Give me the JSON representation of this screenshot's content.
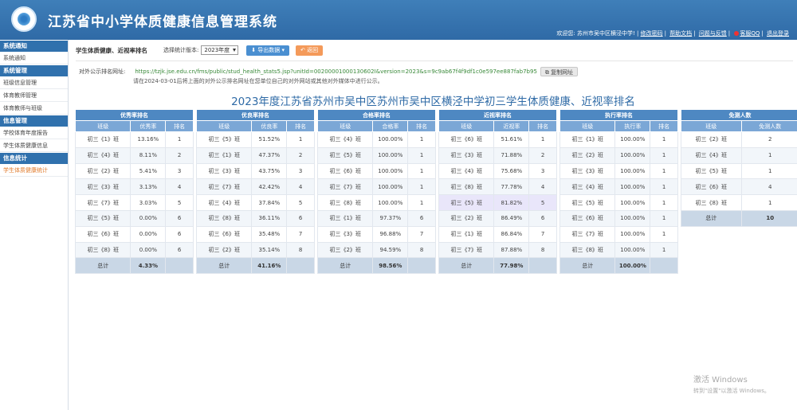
{
  "header": {
    "title": "江苏省中小学体质健康信息管理系统",
    "welcome": "欢迎您: 苏州市吴中区横泾中学! |",
    "links": [
      "修改密码",
      "帮助文档",
      "问题与反馈",
      "客服QQ",
      "退出登录"
    ]
  },
  "sidebar": {
    "sections": [
      {
        "head": "系统通知",
        "items": [
          "系统通知"
        ]
      },
      {
        "head": "系统管理",
        "items": [
          "班级信息管理",
          "体育教师管理",
          "体育教师与班级"
        ]
      },
      {
        "head": "信息管理",
        "items": [
          "学校体育年度报告",
          "学生体质健康信息"
        ]
      },
      {
        "head": "信息统计",
        "items": [
          "学生体质健康统计"
        ]
      }
    ]
  },
  "toolbar": {
    "title": "学生体质健康、近视率排名",
    "version_label": "选择统计版本:",
    "version_value": "2023年度",
    "export_label": "导出数据",
    "back_label": "返回"
  },
  "url": {
    "label": "对外公示排名网址:",
    "value": "https://tzjk.jse.edu.cn/fms/public/stud_health_stats5.jsp?unitId=00200001000130602I&version=2023&s=9c9ab67f4f9df1c0e597ee887fab7b95",
    "copy_label": "复制网址",
    "notice": "请在2024-03-01后将上面的对外公示排名网址在您单位自己的对外网站或其他对外媒体中进行公示。"
  },
  "heading": "2023年度江苏省苏州市吴中区苏州市吴中区横泾中学初三学生体质健康、近视率排名",
  "tables": [
    {
      "caption": "优秀率排名",
      "cols": [
        "班级",
        "优秀率",
        "排名"
      ],
      "highlight": -1,
      "rows": [
        [
          "初三《1》班",
          "13.16%",
          "1"
        ],
        [
          "初三《4》班",
          "8.11%",
          "2"
        ],
        [
          "初三《2》班",
          "5.41%",
          "3"
        ],
        [
          "初三《3》班",
          "3.13%",
          "4"
        ],
        [
          "初三《7》班",
          "3.03%",
          "5"
        ],
        [
          "初三《5》班",
          "0.00%",
          "6"
        ],
        [
          "初三《6》班",
          "0.00%",
          "6"
        ],
        [
          "初三《8》班",
          "0.00%",
          "6"
        ]
      ],
      "total": [
        "总计",
        "4.33%",
        ""
      ]
    },
    {
      "caption": "优良率排名",
      "cols": [
        "班级",
        "优良率",
        "排名"
      ],
      "highlight": -1,
      "rows": [
        [
          "初三《5》班",
          "51.52%",
          "1"
        ],
        [
          "初三《1》班",
          "47.37%",
          "2"
        ],
        [
          "初三《3》班",
          "43.75%",
          "3"
        ],
        [
          "初三《7》班",
          "42.42%",
          "4"
        ],
        [
          "初三《4》班",
          "37.84%",
          "5"
        ],
        [
          "初三《8》班",
          "36.11%",
          "6"
        ],
        [
          "初三《6》班",
          "35.48%",
          "7"
        ],
        [
          "初三《2》班",
          "35.14%",
          "8"
        ]
      ],
      "total": [
        "总计",
        "41.16%",
        ""
      ]
    },
    {
      "caption": "合格率排名",
      "cols": [
        "班级",
        "合格率",
        "排名"
      ],
      "highlight": -1,
      "rows": [
        [
          "初三《4》班",
          "100.00%",
          "1"
        ],
        [
          "初三《5》班",
          "100.00%",
          "1"
        ],
        [
          "初三《6》班",
          "100.00%",
          "1"
        ],
        [
          "初三《7》班",
          "100.00%",
          "1"
        ],
        [
          "初三《8》班",
          "100.00%",
          "1"
        ],
        [
          "初三《1》班",
          "97.37%",
          "6"
        ],
        [
          "初三《3》班",
          "96.88%",
          "7"
        ],
        [
          "初三《2》班",
          "94.59%",
          "8"
        ]
      ],
      "total": [
        "总计",
        "98.56%",
        ""
      ]
    },
    {
      "caption": "近视率排名",
      "cols": [
        "班级",
        "近视率",
        "排名"
      ],
      "highlight": 4,
      "rows": [
        [
          "初三《6》班",
          "51.61%",
          "1"
        ],
        [
          "初三《3》班",
          "71.88%",
          "2"
        ],
        [
          "初三《4》班",
          "75.68%",
          "3"
        ],
        [
          "初三《8》班",
          "77.78%",
          "4"
        ],
        [
          "初三《5》班",
          "81.82%",
          "5"
        ],
        [
          "初三《2》班",
          "86.49%",
          "6"
        ],
        [
          "初三《1》班",
          "86.84%",
          "7"
        ],
        [
          "初三《7》班",
          "87.88%",
          "8"
        ]
      ],
      "total": [
        "总计",
        "77.98%",
        ""
      ]
    },
    {
      "caption": "执行率排名",
      "cols": [
        "班级",
        "执行率",
        "排名"
      ],
      "highlight": -1,
      "rows": [
        [
          "初三《1》班",
          "100.00%",
          "1"
        ],
        [
          "初三《2》班",
          "100.00%",
          "1"
        ],
        [
          "初三《3》班",
          "100.00%",
          "1"
        ],
        [
          "初三《4》班",
          "100.00%",
          "1"
        ],
        [
          "初三《5》班",
          "100.00%",
          "1"
        ],
        [
          "初三《6》班",
          "100.00%",
          "1"
        ],
        [
          "初三《7》班",
          "100.00%",
          "1"
        ],
        [
          "初三《8》班",
          "100.00%",
          "1"
        ]
      ],
      "total": [
        "总计",
        "100.00%",
        ""
      ]
    },
    {
      "caption": "免测人数",
      "cols": [
        "班级",
        "免测人数"
      ],
      "highlight": -1,
      "rows": [
        [
          "初三《2》班",
          "2"
        ],
        [
          "初三《4》班",
          "1"
        ],
        [
          "初三《5》班",
          "1"
        ],
        [
          "初三《6》班",
          "4"
        ],
        [
          "初三《8》班",
          "1"
        ]
      ],
      "total": [
        "总计",
        "10"
      ]
    }
  ],
  "watermark": {
    "line1": "激活 Windows",
    "line2": "转到\"设置\"以激活 Windows。"
  }
}
